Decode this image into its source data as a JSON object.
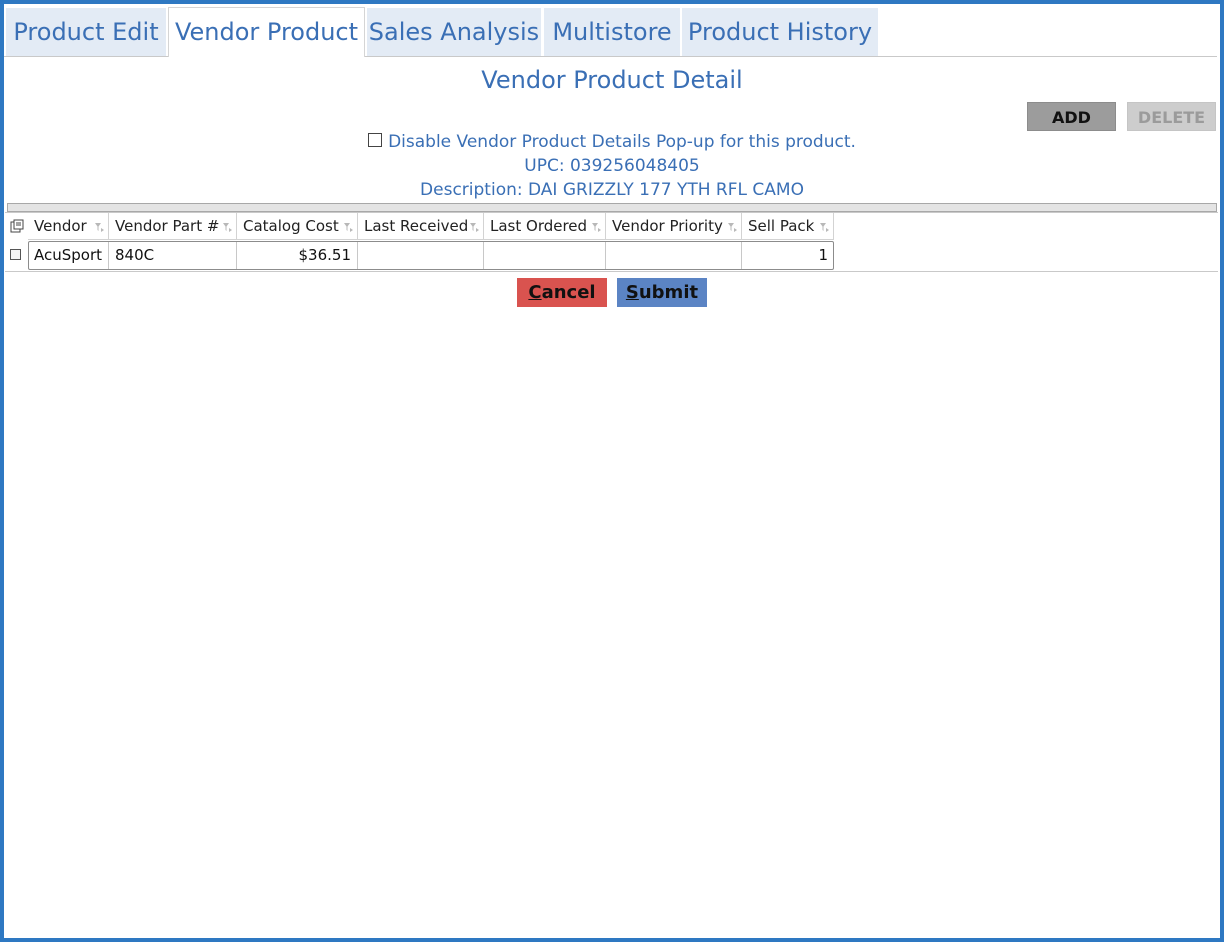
{
  "tabs": [
    {
      "label": "Product Edit"
    },
    {
      "label": "Vendor Product"
    },
    {
      "label": "Sales Analysis"
    },
    {
      "label": "Multistore"
    },
    {
      "label": "Product History"
    }
  ],
  "active_tab": "Vendor Product",
  "page_title": "Vendor Product Detail",
  "actions": {
    "add_label": "ADD",
    "delete_label": "DELETE"
  },
  "popup_option": {
    "label": "Disable Vendor Product Details Pop-up for this product.",
    "checked": false
  },
  "upc_text": "UPC: 039256048405",
  "description_text": "Description: DAI GRIZZLY 177 YTH RFL CAMO",
  "grid": {
    "columns": [
      "Vendor",
      "Vendor Part #",
      "Catalog Cost",
      "Last Received",
      "Last Ordered",
      "Vendor Priority",
      "Sell Pack"
    ],
    "rows": [
      {
        "vendor": "AcuSport",
        "part": "840C",
        "cost": "$36.51",
        "last_received": "",
        "last_ordered": "",
        "priority": "",
        "sell_pack": "1"
      }
    ]
  },
  "footer": {
    "cancel_first": "C",
    "cancel_rest": "ancel",
    "submit_first": "S",
    "submit_rest": "ubmit"
  },
  "colors": {
    "accent_blue": "#3a6fb5",
    "frame": "#2e78c2",
    "cancel": "#d9534f",
    "submit": "#5b84c4"
  }
}
